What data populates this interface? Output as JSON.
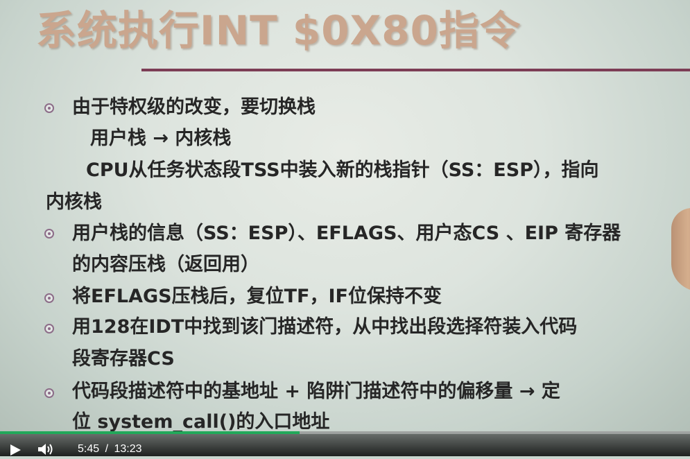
{
  "slide": {
    "title": "系统执行INT $0X80指令",
    "lines": [
      "由于特权级的改变，要切换栈",
      "用户栈 → 内核栈",
      "CPU从任务状态段TSS中装入新的栈指针（SS：ESP），指向",
      "内核栈",
      "用户栈的信息（SS：ESP）、EFLAGS、用户态CS 、EIP 寄存器",
      "的内容压栈（返回用）",
      "将EFLAGS压栈后，复位TF，IF位保持不变",
      "用128在IDT中找到该门描述符，从中找出段选择符装入代码",
      "段寄存器CS",
      "代码段描述符中的基地址 + 陷阱门描述符中的偏移量 →  定",
      "位   system_call()的入口地址"
    ]
  },
  "player": {
    "current_time": "5:45",
    "separator": "/",
    "duration": "13:23",
    "progress_fraction": 0.434,
    "accent_color": "#22a85a",
    "play_icon": "play-icon",
    "volume_icon": "volume-icon"
  }
}
